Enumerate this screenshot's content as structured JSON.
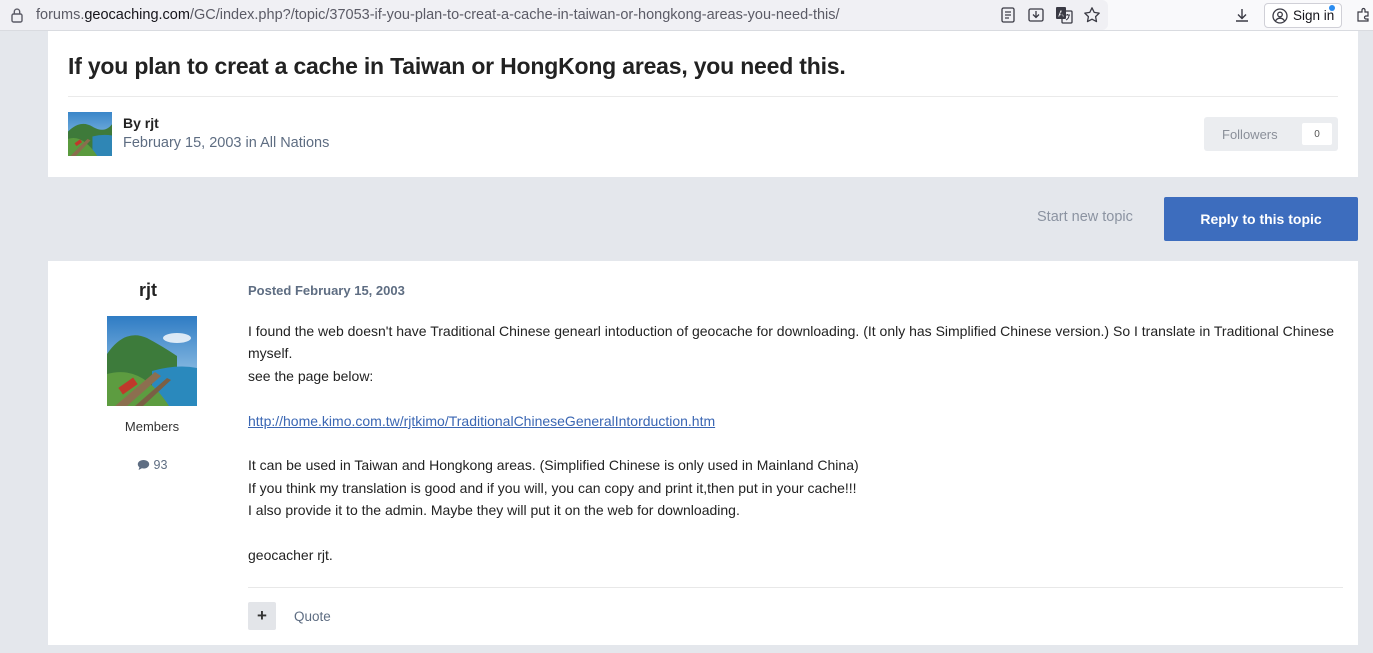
{
  "browser": {
    "url_prefix": "forums.",
    "url_domain": "geocaching.com",
    "url_path": "/GC/index.php?/topic/37053-if-you-plan-to-creat-a-cache-in-taiwan-or-hongkong-areas-you-need-this/",
    "signin_label": "Sign in",
    "icons": [
      "lock-icon",
      "reader-view-icon",
      "save-page-icon",
      "translate-icon",
      "bookmark-star-icon",
      "downloads-icon",
      "account-icon",
      "extensions-icon"
    ]
  },
  "topic": {
    "title": "If you plan to creat a cache in Taiwan or HongKong areas, you need this.",
    "by_prefix": "By",
    "author": "rjt",
    "date": "February 15, 2003",
    "in_word": "in",
    "forum": "All Nations",
    "followers_label": "Followers",
    "followers_count": "0"
  },
  "actions": {
    "start_new_topic": "Start new topic",
    "reply": "Reply to this topic"
  },
  "post": {
    "author": "rjt",
    "group": "Members",
    "post_count": "93",
    "posted_label": "Posted",
    "posted_date": "February 15, 2003",
    "body": {
      "line1": "I found the web doesn't have Traditional Chinese genearl intoduction of geocache for downloading. (It only has Simplified Chinese version.) So I translate in Traditional Chinese myself.",
      "line2": "see the page below:",
      "link": "http://home.kimo.com.tw/rjtkimo/TraditionalChineseGeneralIntorduction.htm",
      "line3": "It can be used in Taiwan and Hongkong areas. (Simplified Chinese is only used in Mainland China)",
      "line4": "If you think my translation is good and if you will, you can copy and print it,then put in your cache!!!",
      "line5": "I also provide it to the admin. Maybe they will put it on the web for downloading.",
      "line6": "geocacher rjt."
    },
    "plus_label": "+",
    "quote_label": "Quote"
  },
  "colors": {
    "accent": "#3d6dbe",
    "page_bg": "#e4e7ec",
    "muted_text": "#5e6d82"
  }
}
